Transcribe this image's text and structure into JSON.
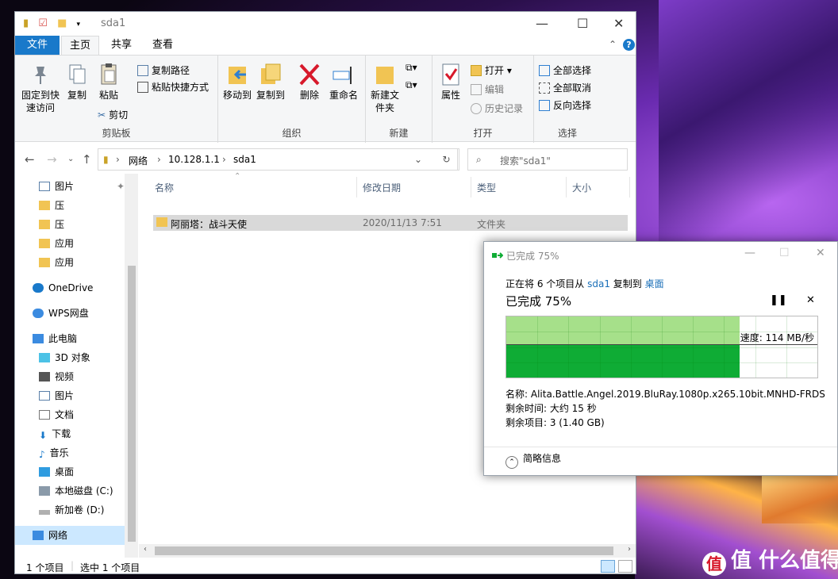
{
  "explorer": {
    "title": "sda1",
    "tabs": [
      "文件",
      "主页",
      "共享",
      "查看"
    ],
    "ribbon": {
      "clipboard": {
        "pin": "固定到快速访问",
        "copy": "复制",
        "paste": "粘贴",
        "copy_path": "复制路径",
        "paste_shortcut": "粘贴快捷方式",
        "cut": "剪切",
        "label": "剪贴板"
      },
      "organize": {
        "move_to": "移动到",
        "copy_to": "复制到",
        "delete": "删除",
        "rename": "重命名",
        "label": "组织"
      },
      "new": {
        "new_folder": "新建文件夹",
        "label": "新建"
      },
      "open": {
        "properties": "属性",
        "open": "打开",
        "edit": "编辑",
        "history": "历史记录",
        "label": "打开"
      },
      "select": {
        "select_all": "全部选择",
        "select_none": "全部取消",
        "invert": "反向选择",
        "label": "选择"
      }
    },
    "address": {
      "crumbs": [
        "网络",
        "10.128.1.1",
        "sda1"
      ]
    },
    "search": {
      "placeholder": "搜索\"sda1\""
    },
    "nav": {
      "quick": [
        "图片",
        "压",
        "压",
        "应用",
        "应用"
      ],
      "onedrive": "OneDrive",
      "wps": "WPS网盘",
      "pc": "此电脑",
      "pc_items": [
        "3D 对象",
        "视频",
        "图片",
        "文档",
        "下载",
        "音乐",
        "桌面",
        "本地磁盘 (C:)",
        "新加卷 (D:)"
      ],
      "network": "网络"
    },
    "columns": [
      "名称",
      "修改日期",
      "类型",
      "大小"
    ],
    "files": [
      {
        "name": "阿丽塔：战斗天使",
        "date": "2020/11/13 7:51",
        "type": "文件夹",
        "size": ""
      }
    ],
    "status": {
      "count": "1 个项目",
      "selected": "选中 1 个项目"
    }
  },
  "copy_dialog": {
    "title": "已完成 75%",
    "line1_pre": "正在将 6 个项目从",
    "source": "sda1",
    "line1_mid": "复制到",
    "dest": "桌面",
    "progress_text": "已完成 75%",
    "progress": 0.75,
    "speed": "速度: 114 MB/秒",
    "name": "名称: Alita.Battle.Angel.2019.BluRay.1080p.x265.10bit.MNHD-FRDS",
    "time_left": "剩余时间: 大约 15 秒",
    "items_left": "剩余项目: 3 (1.40 GB)",
    "less_info": "简略信息"
  },
  "watermark": "值 什么值得买",
  "colors": {
    "accent": "#1979ca",
    "progress_fill": "#a6e08a",
    "progress_dark": "#0fac35"
  }
}
